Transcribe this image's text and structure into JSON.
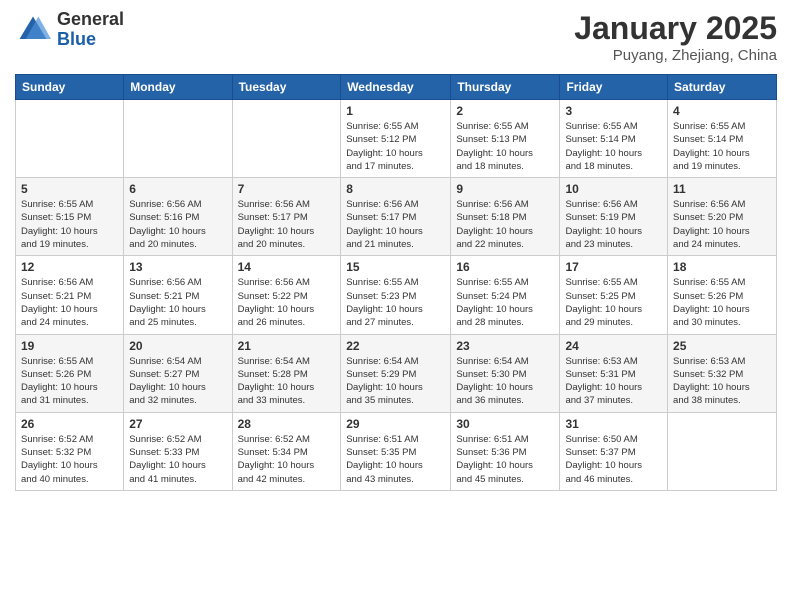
{
  "header": {
    "logo_general": "General",
    "logo_blue": "Blue",
    "month_title": "January 2025",
    "location": "Puyang, Zhejiang, China"
  },
  "weekdays": [
    "Sunday",
    "Monday",
    "Tuesday",
    "Wednesday",
    "Thursday",
    "Friday",
    "Saturday"
  ],
  "weeks": [
    [
      {
        "day": "",
        "info": ""
      },
      {
        "day": "",
        "info": ""
      },
      {
        "day": "",
        "info": ""
      },
      {
        "day": "1",
        "info": "Sunrise: 6:55 AM\nSunset: 5:12 PM\nDaylight: 10 hours\nand 17 minutes."
      },
      {
        "day": "2",
        "info": "Sunrise: 6:55 AM\nSunset: 5:13 PM\nDaylight: 10 hours\nand 18 minutes."
      },
      {
        "day": "3",
        "info": "Sunrise: 6:55 AM\nSunset: 5:14 PM\nDaylight: 10 hours\nand 18 minutes."
      },
      {
        "day": "4",
        "info": "Sunrise: 6:55 AM\nSunset: 5:14 PM\nDaylight: 10 hours\nand 19 minutes."
      }
    ],
    [
      {
        "day": "5",
        "info": "Sunrise: 6:55 AM\nSunset: 5:15 PM\nDaylight: 10 hours\nand 19 minutes."
      },
      {
        "day": "6",
        "info": "Sunrise: 6:56 AM\nSunset: 5:16 PM\nDaylight: 10 hours\nand 20 minutes."
      },
      {
        "day": "7",
        "info": "Sunrise: 6:56 AM\nSunset: 5:17 PM\nDaylight: 10 hours\nand 20 minutes."
      },
      {
        "day": "8",
        "info": "Sunrise: 6:56 AM\nSunset: 5:17 PM\nDaylight: 10 hours\nand 21 minutes."
      },
      {
        "day": "9",
        "info": "Sunrise: 6:56 AM\nSunset: 5:18 PM\nDaylight: 10 hours\nand 22 minutes."
      },
      {
        "day": "10",
        "info": "Sunrise: 6:56 AM\nSunset: 5:19 PM\nDaylight: 10 hours\nand 23 minutes."
      },
      {
        "day": "11",
        "info": "Sunrise: 6:56 AM\nSunset: 5:20 PM\nDaylight: 10 hours\nand 24 minutes."
      }
    ],
    [
      {
        "day": "12",
        "info": "Sunrise: 6:56 AM\nSunset: 5:21 PM\nDaylight: 10 hours\nand 24 minutes."
      },
      {
        "day": "13",
        "info": "Sunrise: 6:56 AM\nSunset: 5:21 PM\nDaylight: 10 hours\nand 25 minutes."
      },
      {
        "day": "14",
        "info": "Sunrise: 6:56 AM\nSunset: 5:22 PM\nDaylight: 10 hours\nand 26 minutes."
      },
      {
        "day": "15",
        "info": "Sunrise: 6:55 AM\nSunset: 5:23 PM\nDaylight: 10 hours\nand 27 minutes."
      },
      {
        "day": "16",
        "info": "Sunrise: 6:55 AM\nSunset: 5:24 PM\nDaylight: 10 hours\nand 28 minutes."
      },
      {
        "day": "17",
        "info": "Sunrise: 6:55 AM\nSunset: 5:25 PM\nDaylight: 10 hours\nand 29 minutes."
      },
      {
        "day": "18",
        "info": "Sunrise: 6:55 AM\nSunset: 5:26 PM\nDaylight: 10 hours\nand 30 minutes."
      }
    ],
    [
      {
        "day": "19",
        "info": "Sunrise: 6:55 AM\nSunset: 5:26 PM\nDaylight: 10 hours\nand 31 minutes."
      },
      {
        "day": "20",
        "info": "Sunrise: 6:54 AM\nSunset: 5:27 PM\nDaylight: 10 hours\nand 32 minutes."
      },
      {
        "day": "21",
        "info": "Sunrise: 6:54 AM\nSunset: 5:28 PM\nDaylight: 10 hours\nand 33 minutes."
      },
      {
        "day": "22",
        "info": "Sunrise: 6:54 AM\nSunset: 5:29 PM\nDaylight: 10 hours\nand 35 minutes."
      },
      {
        "day": "23",
        "info": "Sunrise: 6:54 AM\nSunset: 5:30 PM\nDaylight: 10 hours\nand 36 minutes."
      },
      {
        "day": "24",
        "info": "Sunrise: 6:53 AM\nSunset: 5:31 PM\nDaylight: 10 hours\nand 37 minutes."
      },
      {
        "day": "25",
        "info": "Sunrise: 6:53 AM\nSunset: 5:32 PM\nDaylight: 10 hours\nand 38 minutes."
      }
    ],
    [
      {
        "day": "26",
        "info": "Sunrise: 6:52 AM\nSunset: 5:32 PM\nDaylight: 10 hours\nand 40 minutes."
      },
      {
        "day": "27",
        "info": "Sunrise: 6:52 AM\nSunset: 5:33 PM\nDaylight: 10 hours\nand 41 minutes."
      },
      {
        "day": "28",
        "info": "Sunrise: 6:52 AM\nSunset: 5:34 PM\nDaylight: 10 hours\nand 42 minutes."
      },
      {
        "day": "29",
        "info": "Sunrise: 6:51 AM\nSunset: 5:35 PM\nDaylight: 10 hours\nand 43 minutes."
      },
      {
        "day": "30",
        "info": "Sunrise: 6:51 AM\nSunset: 5:36 PM\nDaylight: 10 hours\nand 45 minutes."
      },
      {
        "day": "31",
        "info": "Sunrise: 6:50 AM\nSunset: 5:37 PM\nDaylight: 10 hours\nand 46 minutes."
      },
      {
        "day": "",
        "info": ""
      }
    ]
  ]
}
